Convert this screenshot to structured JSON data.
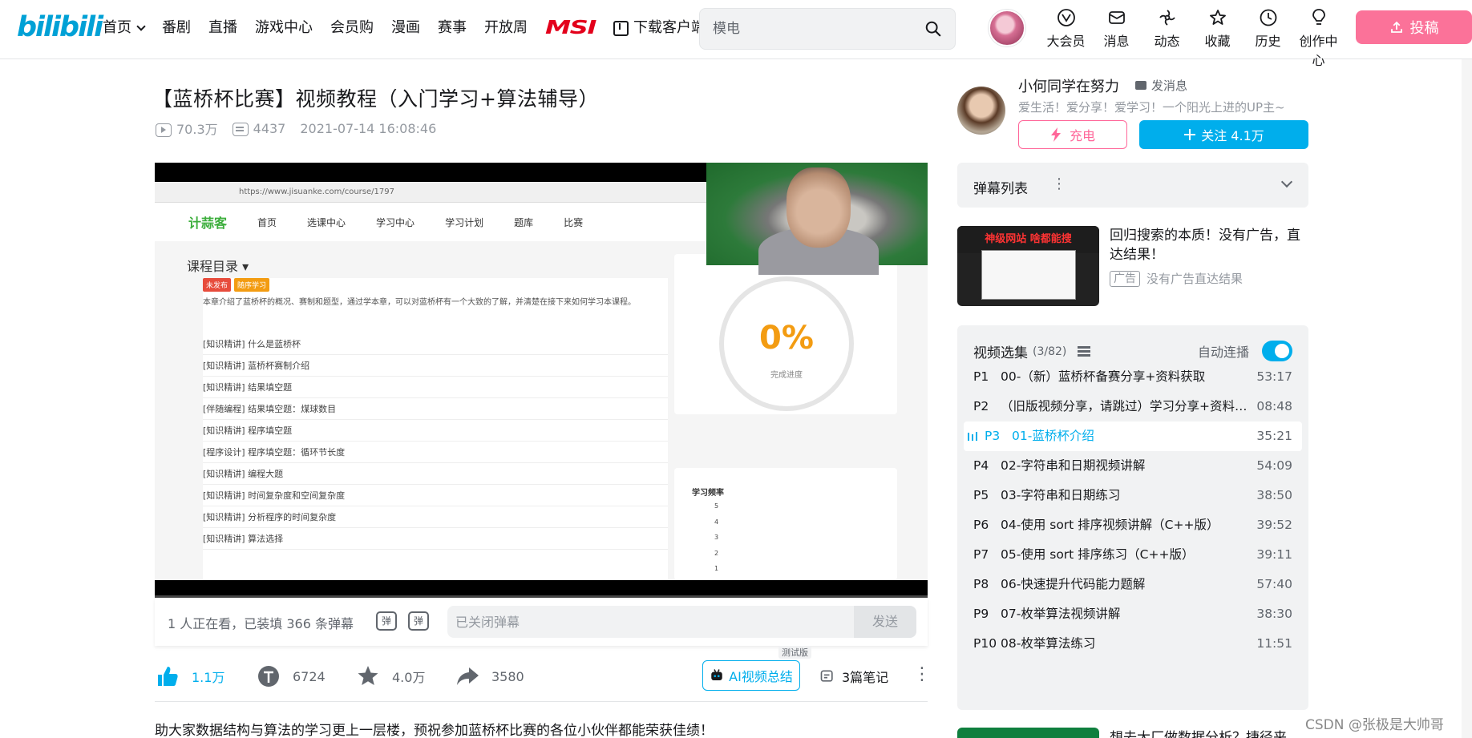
{
  "header": {
    "logo": "bilibili",
    "nav": [
      "首页",
      "番剧",
      "直播",
      "游戏中心",
      "会员购",
      "漫画",
      "赛事",
      "开放周"
    ],
    "msi": "MSI",
    "download": "下载客户端",
    "search_placeholder": "模电",
    "icons": [
      {
        "label": "大会员",
        "icon": "vip-icon"
      },
      {
        "label": "消息",
        "icon": "message-icon"
      },
      {
        "label": "动态",
        "icon": "dynamic-icon"
      },
      {
        "label": "收藏",
        "icon": "favorite-icon"
      },
      {
        "label": "历史",
        "icon": "history-icon"
      },
      {
        "label": "创作中心",
        "icon": "creator-icon"
      }
    ],
    "upload": "投稿",
    "accent": "#fb7299"
  },
  "video": {
    "title": "【蓝桥杯比赛】视频教程（入门学习+算法辅导）",
    "views": "70.3万",
    "danmaku_count": "4437",
    "date": "2021-07-14 16:08:46"
  },
  "screen": {
    "url": "https://www.jisuanke.com/course/1797",
    "site_logo": "计蒜客",
    "site_nav": [
      "首页",
      "选课中心",
      "学习中心",
      "学习计划",
      "题库",
      "比赛"
    ],
    "course_dir": "课程目录",
    "tags": [
      "未发布",
      "随序学习"
    ],
    "course_desc": "本章介绍了蓝桥杯的概况、赛制和题型，通过学本章，可以对蓝桥杯有一个大致的了解，并清楚在接下来如何学习本课程。",
    "lessons": [
      "[知识精讲]   什么是蓝桥杯",
      "[知识精讲]   蓝桥杯赛制介绍",
      "[知识精讲]   结果填空题",
      "[伴随编程]   结果填空题：煤球数目",
      "[知识精讲]   程序填空题",
      "[程序设计]   程序填空题：循环节长度",
      "[知识精讲]   编程大题",
      "[知识精讲]   时间复杂度和空间复杂度",
      "[知识精讲]   分析程序的时间复杂度",
      "[知识精讲]   算法选择"
    ],
    "progress_pct": "0%",
    "progress_label": "完成进度",
    "freq_title": "学习频率",
    "freq_axis": [
      "5",
      "4",
      "3",
      "2",
      "1"
    ]
  },
  "danmaku_bar": {
    "viewers": "1 人正在看，已装填 366 条弹幕",
    "toggle1": "弹",
    "toggle2": "弹",
    "input_placeholder": "已关闭弹幕",
    "send": "发送"
  },
  "actions": {
    "like": "1.1万",
    "coin": "6724",
    "fav": "4.0万",
    "share": "3580",
    "ai": "AI视频总结",
    "test_tag": "测试版",
    "notes": "3篇笔记"
  },
  "description": "助大家数据结构与算法的学习更上一层楼，预祝参加蓝桥杯比赛的各位小伙伴都能荣获佳绩！",
  "uploader": {
    "name": "小何同学在努力",
    "send_msg": "发消息",
    "sign": "爱生活！爱分享！爱学习！一个阳光上进的UP主~",
    "charge": "充电",
    "follow": "关注 4.1万"
  },
  "danmaku_list": {
    "title": "弹幕列表"
  },
  "ad": {
    "banner": "神级网站  啥都能搜",
    "title": "回归搜索的本质！没有广告，直达结果！",
    "badge": "广告",
    "desc": "没有广告直达结果"
  },
  "playlist": {
    "title": "视频选集",
    "count": "(3/82)",
    "autoplay": "自动连播",
    "items": [
      {
        "idx": "P1",
        "title": "00-（新）蓝桥杯备赛分享+资料获取",
        "dur": "53:17"
      },
      {
        "idx": "P2",
        "title": "（旧版视频分享，请跳过）学习分享+资料获取",
        "dur": "08:48"
      },
      {
        "idx": "P3",
        "title": "01-蓝桥杯介绍",
        "dur": "35:21"
      },
      {
        "idx": "P4",
        "title": "02-字符串和日期视频讲解",
        "dur": "54:09"
      },
      {
        "idx": "P5",
        "title": "03-字符串和日期练习",
        "dur": "38:50"
      },
      {
        "idx": "P6",
        "title": "04-使用 sort 排序视频讲解（C++版）",
        "dur": "39:52"
      },
      {
        "idx": "P7",
        "title": "05-使用 sort 排序练习（C++版）",
        "dur": "39:11"
      },
      {
        "idx": "P8",
        "title": "06-快速提升代码能力题解",
        "dur": "57:40"
      },
      {
        "idx": "P9",
        "title": "07-枚举算法视频讲解",
        "dur": "38:30"
      },
      {
        "idx": "P10",
        "title": "08-枚举算法练习",
        "dur": "11:51"
      }
    ],
    "active_index": 2
  },
  "next_rec": {
    "title": "想去大厂做数据分析？捷径来"
  },
  "watermark": "CSDN @张极是大帅哥"
}
